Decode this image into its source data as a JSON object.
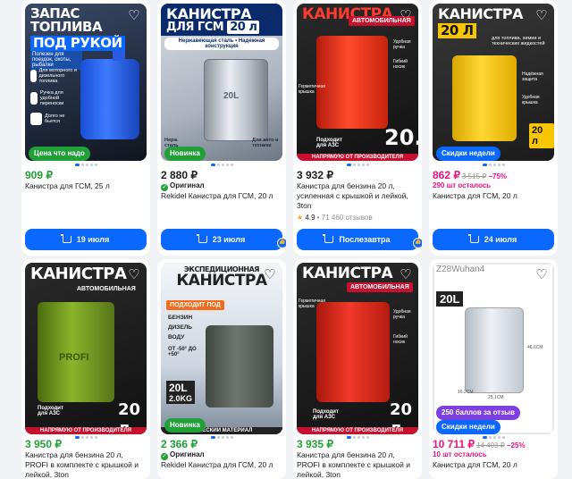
{
  "cards": [
    {
      "image": {
        "headline": "ЗАПАС ТОПЛИВА",
        "headline2": "ПОД РУКОЙ",
        "features": [
          "Для моторного и дизельного топлива",
          "Ручка для удобной переноски",
          "Долго не бьется"
        ],
        "footer_text": "Полезен для поездок, охоты, рыбалки",
        "badge": "Цена что надо"
      },
      "price": "909 ₽",
      "title": "Канистра для ГСМ, 25 л",
      "button": "19 июля"
    },
    {
      "image": {
        "headline": "КАНИСТРА",
        "headline2": "ДЛЯ ГСМ",
        "volume": "20 л",
        "tagline": "Нержавеющая сталь • Надежная конструкция",
        "label_on_can": "20L",
        "side_texts": [
          "Нерж. сталь",
          "Для авто и техники"
        ],
        "badge": "Новинка"
      },
      "price": "2 880 ₽",
      "original_label": "Оригинал",
      "title": "Rekidel Канистра для ГСМ, 20 л",
      "button": "23 июля"
    },
    {
      "image": {
        "headline": "КАНИСТРА",
        "tag": "АВТОМОБИЛЬНАЯ",
        "side_texts": [
          "Герметичная крышка",
          "Удобная ручка",
          "Гибкий носик"
        ],
        "bottom_left": "Подходит для АЗС",
        "big_number": "20.",
        "ribbon": "НАПРЯМУЮ ОТ ПРОИЗВОДИТЕЛЯ"
      },
      "price": "3 932 ₽",
      "title": "Канистра для бензина 20 л, усиленная с крышкой и лейкой, 3ton",
      "rating": "4.9",
      "reviews": "71 460 отзывов",
      "button": "Послезавтра"
    },
    {
      "image": {
        "headline": "КАНИСТРА",
        "volume": "20 Л",
        "tagline": "для топлива, химии и технических жидкостей",
        "side_texts": [
          "Надёжная защита",
          "Удобная крышка"
        ],
        "bottom_right": "20 л",
        "badge": "Скидки недели"
      },
      "price": "862 ₽",
      "old_price": "3 515 ₽",
      "discount": "−75%",
      "stock": "290 шт осталось",
      "title": "Канистра для ГСМ, 20 л",
      "button": "24 июля"
    },
    {
      "image": {
        "headline": "КАНИСТРА",
        "tag": "АВТОМОБИЛЬНАЯ",
        "label_on_can": "PROFI",
        "bottom_left": "Подходит для АЗС",
        "big_number": "20 л",
        "ribbon": "НАПРЯМУЮ ОТ ПРОИЗВОДИТЕЛЯ"
      },
      "price": "3 950 ₽",
      "title": "Канистра для бензина 20 л, PROFI в комплекте с крышкой и лейкой, 3ton"
    },
    {
      "image": {
        "headline_small": "ЭКСПЕДИЦИОННАЯ",
        "headline": "КАНИСТРА",
        "tag": "ПОДХОДИТ ПОД",
        "list": [
          "БЕНЗИН",
          "ДИЗЕЛЬ",
          "ВОДУ"
        ],
        "temp": "ОТ -50° ДО +50°",
        "volume": "20L",
        "volume2": "2.0KG",
        "ribbon": "ЛИЧЕСКИЙ МАТЕРИАЛ",
        "badge": "Новинка"
      },
      "price": "2 366 ₽",
      "original_label": "Оригинал",
      "title": "Rekidel Канистра для ГСМ, 20 л"
    },
    {
      "image": {
        "headline": "КАНИСТРА",
        "tag": "АВТОМОБИЛЬНАЯ",
        "side_texts": [
          "Герметичная крышка",
          "Удобная ручка",
          "Гибкий носик"
        ],
        "bottom_left": "Подходит для АЗС",
        "big_number": "20 л",
        "ribbon": "НАПРЯМУЮ ОТ ПРОИЗВОДИТЕЛЯ"
      },
      "price": "3 935 ₽",
      "title": "Канистра для бензина 20 л, PROFI в комплекте с крышкой и лейкой, 3ton"
    },
    {
      "image": {
        "watermark": "Z28Wuhan4",
        "volume": "20L",
        "dims": [
          "46.6CM",
          "25.1CM",
          "16.2CM"
        ],
        "badge": "250 баллов за отзыв",
        "badge2": "Скидки недели"
      },
      "price": "10 711 ₽",
      "old_price": "14 403 ₽",
      "discount": "−25%",
      "stock": "10 шт осталось",
      "title": "Канистра для ГСМ, 20 л"
    }
  ],
  "colors": {
    "accent": "#0a68ff",
    "price_green": "#21a038",
    "price_pink": "#f1117e",
    "background": "#f0f2f5"
  }
}
